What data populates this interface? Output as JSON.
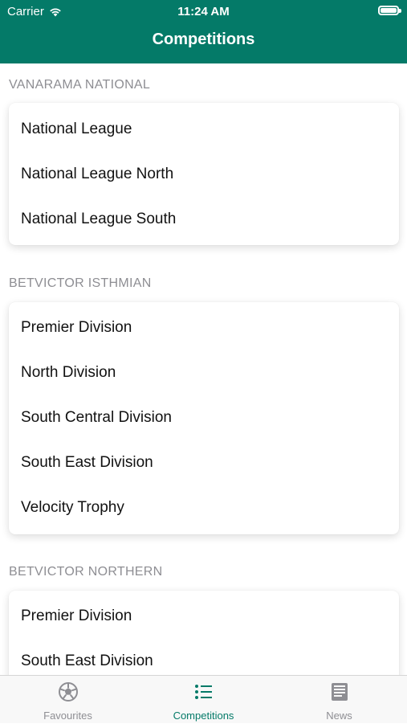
{
  "status_bar": {
    "carrier": "Carrier",
    "time": "11:24 AM"
  },
  "nav": {
    "title": "Competitions"
  },
  "sections": [
    {
      "title": "VANARAMA NATIONAL",
      "items": [
        "National League",
        "National League North",
        "National League South"
      ]
    },
    {
      "title": "BETVICTOR ISTHMIAN",
      "items": [
        "Premier Division",
        "North Division",
        "South Central Division",
        "South East Division",
        "Velocity Trophy"
      ]
    },
    {
      "title": "BETVICTOR NORTHERN",
      "items": [
        "Premier Division",
        "South East Division"
      ]
    }
  ],
  "tabs": [
    {
      "label": "Favourites",
      "icon": "soccer-ball-icon"
    },
    {
      "label": "Competitions",
      "icon": "list-icon",
      "active": true
    },
    {
      "label": "News",
      "icon": "newspaper-icon"
    }
  ],
  "colors": {
    "accent": "#047a68",
    "inactive": "#8e8e93"
  }
}
